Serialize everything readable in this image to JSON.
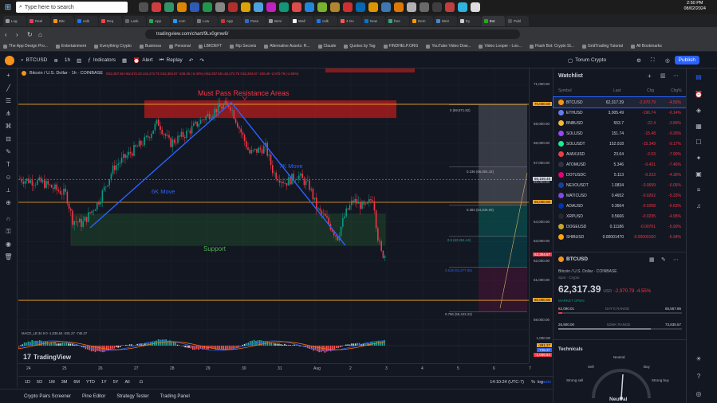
{
  "taskbar": {
    "search_placeholder": "Type here to search",
    "clock_time": "2:50 PM",
    "clock_date": "08/02/2024"
  },
  "browser": {
    "tabs": [
      "Log",
      "Reel",
      "Bitc",
      "calk",
      "Req",
      "Lask",
      "App",
      "com",
      "Low",
      "App",
      "Pass",
      "Beni",
      "Wall",
      "calk",
      "4 Go",
      "Now",
      "free",
      "Dem",
      "Weir",
      "Ey",
      "Ext",
      "Publ"
    ],
    "url": "tradingview.com/chart/9Lx0gmw6/",
    "bookmarks": [
      "The App Design Pro...",
      "Entertainment",
      "Everything Crypto",
      "Business",
      "Personal",
      "LBKDEFT",
      "Rip Secrets",
      "Alternative Assets: R...",
      "Claude",
      "Quotes by Tag",
      "FINDHELP.ORG",
      "YouTube Video Dow...",
      "Video Looper - Loo...",
      "Flash Bot: Crypto St...",
      "GridTrading Tutorial",
      "All Bookmarks"
    ]
  },
  "toolbar": {
    "symbol": "BTCUSD",
    "interval": "1h",
    "indicators_label": "Indicators",
    "alert_label": "Alert",
    "replay_label": "Replay",
    "layout_name": "Torum Crypto",
    "publish_label": "Publish"
  },
  "chart": {
    "title": "Bitcoin / U.S. Dollar · 1h · COINBASE",
    "ohlc": "O62,357.56 H62,672.33 L62,272.75 C62,304.67 -248.46 (-0.40%) H62,357.56 L62,272.75 C62,304.67 -248.46 -2,970.79 (-4.55%)",
    "annotation_resistance": "Must Pass Resistance Areas",
    "annotation_6k": "6K Move",
    "annotation_7k": "7K Move",
    "annotation_support": "Support",
    "fib_0": "0 (69,971.82)",
    "fib_0236": "0.236 (66,804.42)",
    "fib_0382": "0.382 (64,845.06)",
    "fib_05": "0.5 (63,261.44)",
    "fib_0618": "0.618 (61,677.86)",
    "fib_0786": "0.786 (59,423.22)",
    "macd_label": "MACD_LB 34 9 0 -1,036.64 -291.27 -745.37",
    "brand": "TradingView",
    "price_axis": [
      "71,000.00",
      "70,000.00",
      "69,000.00",
      "68,000.00",
      "67,000.00",
      "66,000.00",
      "65,000.00",
      "64,000.00",
      "63,000.00",
      "62,000.00",
      "61,000.00",
      "60,000.00",
      "59,000.00"
    ],
    "price_tags": {
      "p70000": "70,000.00",
      "p66169": "66,169.48",
      "p65000": "65,000.00",
      "p62304": "62,304.67",
      "p60000": "60,000.00",
      "macd1": "1,000.00",
      "macd2": "-291.27",
      "macd3": "-745.37",
      "macd4": "-1,036.64"
    },
    "time_axis": [
      "24",
      "25",
      "26",
      "27",
      "28",
      "29",
      "30",
      "31",
      "Aug",
      "2",
      "3",
      "4",
      "5",
      "6",
      "7"
    ],
    "resistance_price_low": 69300,
    "resistance_price_high": 70200,
    "support_price_low": 62800,
    "support_price_high": 64400,
    "hline_70000": 70000,
    "hline_65000": 65000,
    "hline_60000": 60000,
    "hline_66169": 66169.48
  },
  "timeframes": [
    "1D",
    "5D",
    "1M",
    "3M",
    "6M",
    "YTD",
    "1Y",
    "5Y",
    "All"
  ],
  "clock_utc": "14:10:24 (UTC-7)",
  "bottom_tabs": [
    "Crypto Pairs Screener",
    "Pine Editor",
    "Strategy Tester",
    "Trading Panel"
  ],
  "watchlist": {
    "title": "Watchlist",
    "col_symbol": "Symbol",
    "col_last": "Last",
    "col_chg": "Chg",
    "col_chgp": "Chg%",
    "rows": [
      {
        "sym": "BTCUSD",
        "last": "62,317.39",
        "chg": "-2,970.79",
        "chgp": "-4.55%",
        "color": "#f7931a"
      },
      {
        "sym": "ETHUSD",
        "last": "3,005.49",
        "chg": "-196.74",
        "chgp": "-6.14%",
        "color": "#627eea"
      },
      {
        "sym": "BNBUSD",
        "last": "553.7",
        "chg": "-22.4",
        "chgp": "-3.89%",
        "color": "#f3ba2f"
      },
      {
        "sym": "SOLUSD",
        "last": "151.74",
        "chg": "-15.48",
        "chgp": "-9.26%",
        "color": "#9945ff"
      },
      {
        "sym": "SOLUSDT",
        "last": "152.018",
        "chg": "-15.349",
        "chgp": "-9.17%",
        "color": "#14f195"
      },
      {
        "sym": "AVAXUSD",
        "last": "23.64",
        "chg": "-2.03",
        "chgp": "-7.90%",
        "color": "#e84142"
      },
      {
        "sym": "ATOMUSD",
        "last": "5.346",
        "chg": "-0.431",
        "chgp": "-7.46%",
        "color": "#2e3148"
      },
      {
        "sym": "DOTUSDC",
        "last": "5.113",
        "chg": "-0.233",
        "chgp": "-4.36%",
        "color": "#e6007a"
      },
      {
        "sym": "NEXOUSDT",
        "last": "1.0834",
        "chg": "-0.0699",
        "chgp": "-6.06%",
        "color": "#1a4199"
      },
      {
        "sym": "MATICUSD",
        "last": "0.4652",
        "chg": "-0.0262",
        "chgp": "-5.33%",
        "color": "#8247e5"
      },
      {
        "sym": "ADAUSD",
        "last": "0.3664",
        "chg": "-0.0268",
        "chgp": "-6.63%",
        "color": "#0033ad"
      },
      {
        "sym": "XRPUSD",
        "last": "0.5666",
        "chg": "-0.0295",
        "chgp": "-4.95%",
        "color": "#23292f"
      },
      {
        "sym": "DOGEUSD",
        "last": "0.11186",
        "chg": "-0.00701",
        "chgp": "-5.90%",
        "color": "#c2a633"
      },
      {
        "sym": "SHIBUSD",
        "last": "0.00001470",
        "chg": "-0.00000100",
        "chgp": "-6.34%",
        "color": "#ffa409"
      }
    ]
  },
  "details": {
    "symbol": "BTCUSD",
    "name": "Bitcoin / U.S. Dollar · COINBASE",
    "sub": "Spot · Crypto",
    "price_main": "62,3",
    "price_small": "17.39",
    "currency": "USD",
    "change": "-2,970.79 -4.55%",
    "market_status": "MARKET OPEN",
    "day_low": "62,090.01",
    "day_high": "65,557.86",
    "day_range_label": "DAY'S RANGE",
    "wk_low": "26,900.00",
    "wk_high": "73,835.57",
    "wk_range_label": "52WK RANGE",
    "tech_title": "Technicals",
    "gauge_neutral": "Neutral",
    "gauge_sell": "Sell",
    "gauge_buy": "Buy",
    "gauge_strong_sell": "Strong sell",
    "gauge_strong_buy": "Strong buy",
    "gauge_result": "Neutral"
  }
}
